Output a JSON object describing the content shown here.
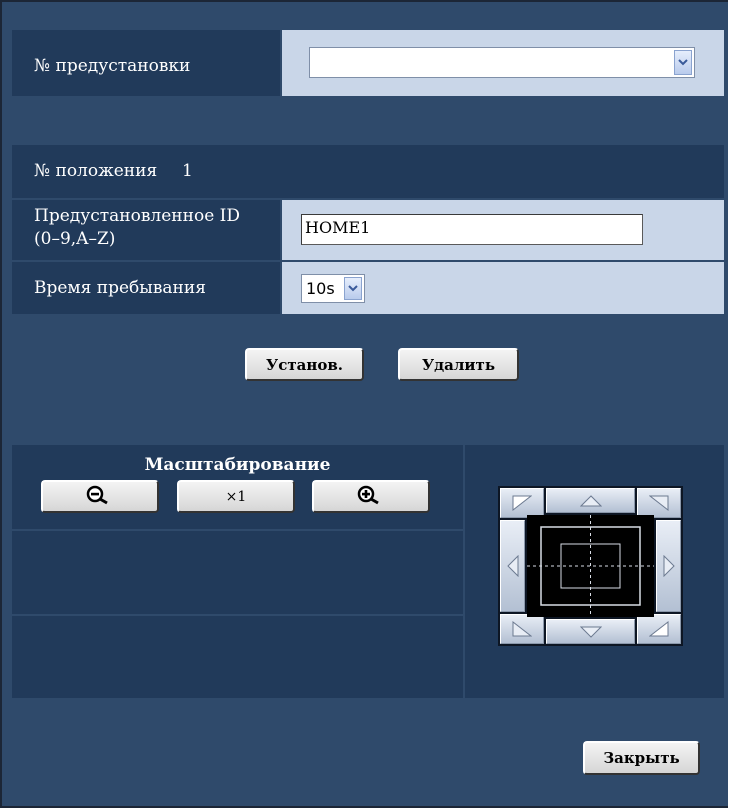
{
  "preset": {
    "label": "№ предустановки",
    "selected": ""
  },
  "position": {
    "label": "№ положения",
    "value": "1"
  },
  "preset_id": {
    "label_line1": "Предустановленное ID",
    "label_line2": "(0–9,A–Z)",
    "value": "HOME1"
  },
  "dwell": {
    "label": "Время пребывания",
    "value": "10s"
  },
  "actions": {
    "set_label": "Установ.",
    "delete_label": "Удалить"
  },
  "zoom": {
    "title": "Масштабирование",
    "x1_label": "×1",
    "zoom_out_icon": "zoom-out-icon",
    "zoom_in_icon": "zoom-in-icon"
  },
  "footer": {
    "close_label": "Закрыть"
  },
  "colors": {
    "panel_bg": "#2f4a6b",
    "row_dark": "#213a5a",
    "row_light": "#c9d6e8"
  }
}
